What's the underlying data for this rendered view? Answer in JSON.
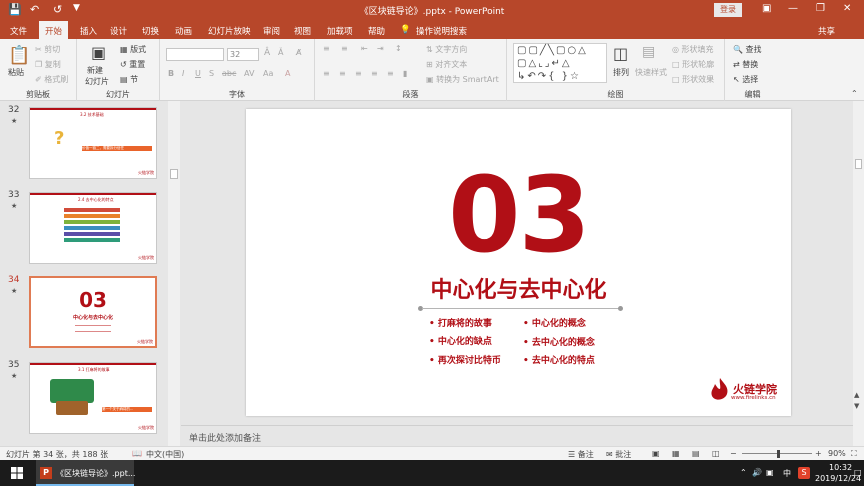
{
  "window": {
    "title": "《区块链导论》.pptx  -  PowerPoint",
    "login_label": "登录",
    "share_label": "共享"
  },
  "tabs": [
    "文件",
    "开始",
    "插入",
    "设计",
    "切换",
    "动画",
    "幻灯片放映",
    "审阅",
    "视图",
    "加载项",
    "帮助"
  ],
  "tell_me": "操作说明搜索",
  "ribbon": {
    "clipboard": {
      "paste": "粘贴",
      "cut": "剪切",
      "copy": "复制",
      "format_painter": "格式刷",
      "label": "剪贴板"
    },
    "slides": {
      "new_slide": "新建",
      "new_slide2": "幻灯片",
      "layout": "版式",
      "reset": "重置",
      "section": "节",
      "label": "幻灯片"
    },
    "font": {
      "size": "32",
      "label": "字体"
    },
    "paragraph": {
      "text_direction": "文字方向",
      "align_text": "对齐文本",
      "smartart": "转换为 SmartArt",
      "label": "段落"
    },
    "drawing": {
      "arrange": "排列",
      "quick_styles": "快速样式",
      "shape_fill": "形状填充",
      "shape_outline": "形状轮廓",
      "shape_effects": "形状效果",
      "label": "绘图"
    },
    "editing": {
      "find": "查找",
      "replace": "替换",
      "select": "选择",
      "label": "编辑"
    }
  },
  "thumbnails": [
    {
      "num": "32",
      "caption": "3.2 技术基础",
      "note": "价值一链二，需要拆分信任"
    },
    {
      "num": "33",
      "caption": "2.4 去中心化的特点"
    },
    {
      "num": "34",
      "caption": "03",
      "sub": "中心化与去中心化"
    },
    {
      "num": "35",
      "caption": "3.1 打麻将的故事",
      "note": "第一个关于麻将的..."
    }
  ],
  "slide": {
    "number_text": "03",
    "title": "中心化与去中心化",
    "bullets_left": [
      "打麻将的故事",
      "中心化的缺点",
      "再次探讨比特币"
    ],
    "bullets_right": [
      "中心化的概念",
      "去中心化的概念",
      "去中心化的特点"
    ],
    "logo_text": "火链学院",
    "logo_url": "www.firelinks.cn"
  },
  "notes_placeholder": "单击此处添加备注",
  "status": {
    "slide_info": "幻灯片 第 34 张，共 188 张",
    "language": "中文(中国)",
    "notes": "备注",
    "comments": "批注",
    "zoom": "90%"
  },
  "taskbar": {
    "app_item": "《区块链导论》.ppt...",
    "ime": "中",
    "time": "10:32",
    "date": "2019/12/24"
  },
  "colors": {
    "accent": "#b7472a",
    "slide_red": "#b10f16"
  }
}
